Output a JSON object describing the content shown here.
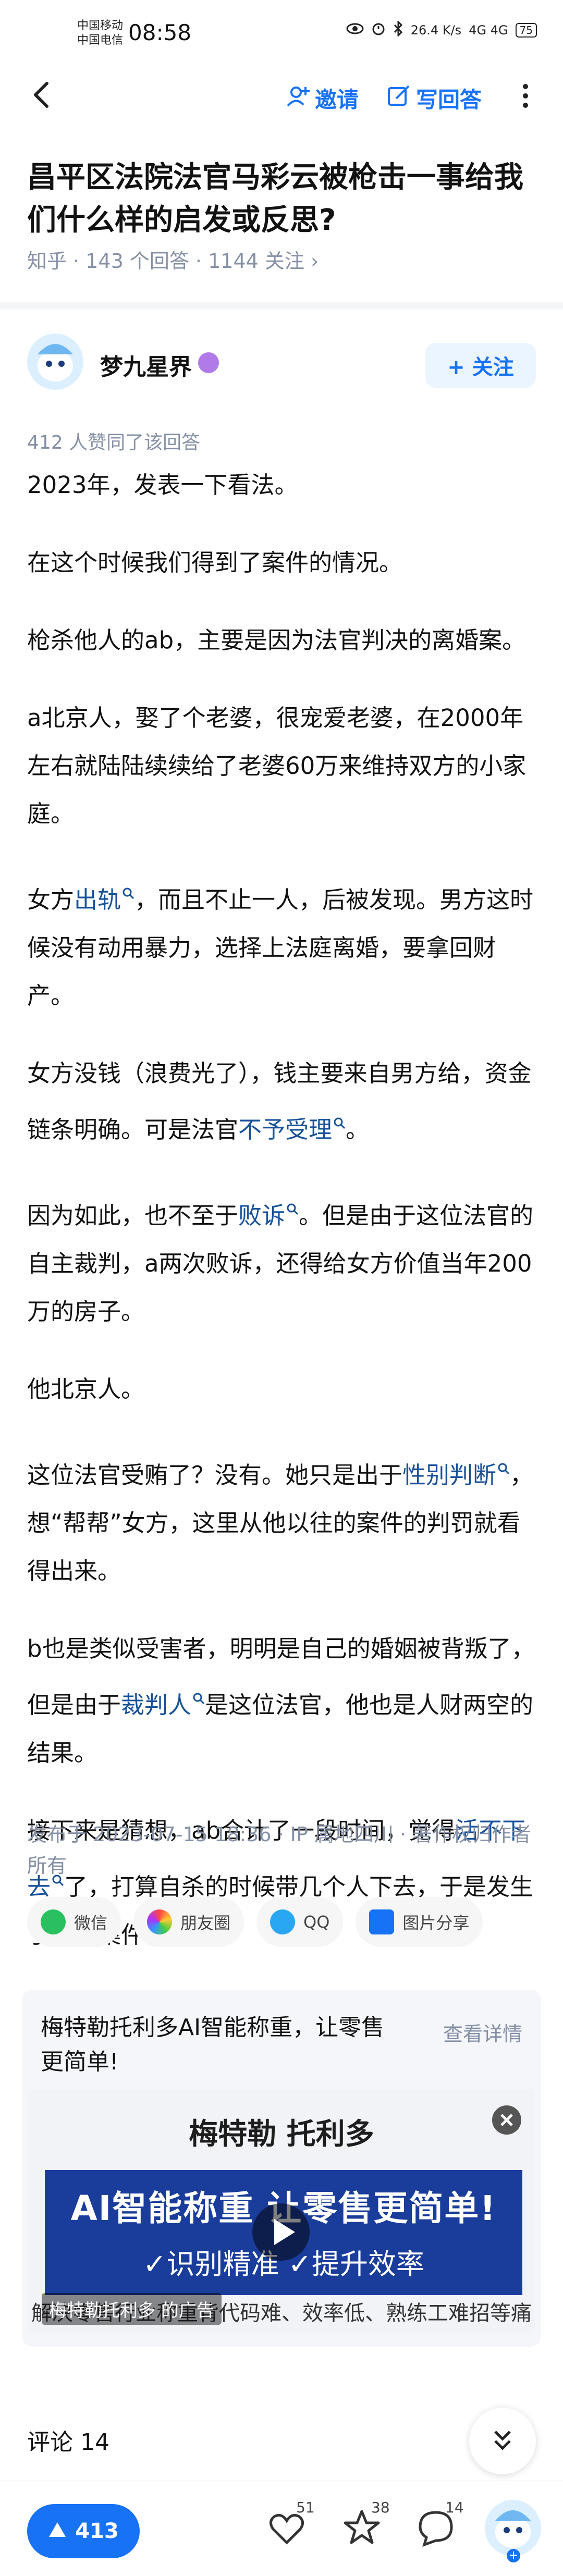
{
  "status_bar": {
    "carrier_1": "中国移动",
    "carrier_2": "中国电信",
    "time": "08:58",
    "net_speed": "26.4 K/s",
    "network": "4G 4G",
    "battery": "75"
  },
  "nav": {
    "invite_label": "邀请",
    "write_label": "写回答"
  },
  "question": {
    "title": "昌平区法院法官马彩云被枪击一事给我们什么样的启发或反思?",
    "meta": "知乎 · 143 个回答 · 1144 关注 ›"
  },
  "author": {
    "name": "梦九星界",
    "follow_label": "+ 关注"
  },
  "upvote_line": "412 人赞同了该回答",
  "answer": {
    "p1": "2023年，发表一下看法。",
    "p2": "在这个时候我们得到了案件的情况。",
    "p3": "枪杀他人的ab，主要是因为法官判决的离婚案。",
    "p4": "a北京人，娶了个老婆，很宠爱老婆，在2000年左右就陆陆续续给了老婆60万来维持双方的小家庭。",
    "p5_a": "女方",
    "p5_kw": "出轨",
    "p5_b": "，而且不止一人，后被发现。男方这时候没有动用暴力，选择上法庭离婚，要拿回财产。",
    "p6_a": "女方没钱（浪费光了），钱主要来自男方给，资金链条明确。可是法官",
    "p6_kw": "不予受理",
    "p6_b": "。",
    "p7_a": "因为如此，也不至于",
    "p7_kw": "败诉",
    "p7_b": "。但是由于这位法官的自主裁判，a两次败诉，还得给女方价值当年200万的房子。",
    "p8": "他北京人。",
    "p9_a": "这位法官受贿了？没有。她只是出于",
    "p9_kw": "性别判断",
    "p9_b": "，想“帮帮”女方，这里从他以往的案件的判罚就看得出来。",
    "p10_a": "b也是类似受害者，明明是自己的婚姻被背叛了，但是由于",
    "p10_kw": "裁判人",
    "p10_b": "是这位法官，他也是人财两空的结果。",
    "p11_a": "接下来是猜想，ab合计了一段时间，觉得",
    "p11_kw": "活不下去",
    "p11_b": "了，打算自杀的时候带几个人下去，于是发生了这个案件。"
  },
  "publish_info": "发布于 2023-07-15 18:36 · IP 属地四川 · 著作权归作者所有",
  "share": {
    "wechat": "微信",
    "moments": "朋友圈",
    "qq": "QQ",
    "image": "图片分享"
  },
  "ad": {
    "title": "梅特勒托利多AI智能称重，让零售更简单!",
    "detail_label": "查看详情",
    "brand": "梅特勒 托利多",
    "headline": "AI智能称重 让零售更简单!",
    "subline": "✓识别精准 ✓提升效率",
    "description": "解决零售行业称重背代码难、效率低、熟练工难招等痛点",
    "label": "梅特勒托利多 的广告"
  },
  "comments": {
    "label": "评论 14"
  },
  "bottom_bar": {
    "vote_count": "413",
    "like_count": "51",
    "star_count": "38",
    "comment_count": "14"
  },
  "colors": {
    "brand_blue": "#1772f6",
    "keyword_blue": "#175199",
    "meta_gray": "#8590a6"
  }
}
